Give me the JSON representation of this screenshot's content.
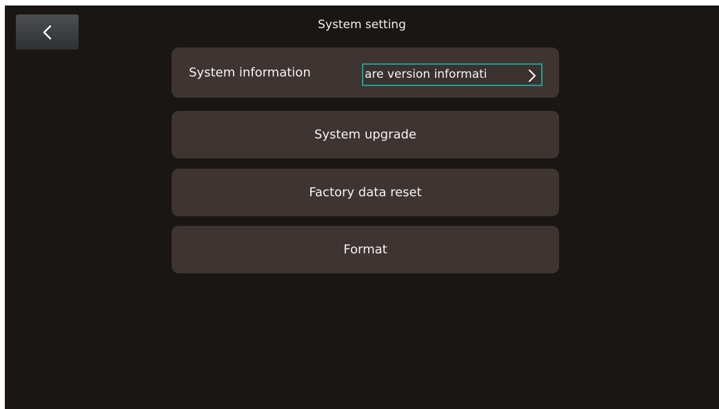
{
  "header": {
    "title": "System setting",
    "back_icon": "chevron-left-icon"
  },
  "settings": {
    "system_information": {
      "label": "System information",
      "value": "are version informati",
      "arrow_icon": "chevron-right-icon"
    },
    "system_upgrade": {
      "label": "System upgrade"
    },
    "factory_data_reset": {
      "label": "Factory data reset"
    },
    "format": {
      "label": "Format"
    }
  },
  "colors": {
    "background": "#1a1613",
    "row": "#3e3431",
    "focus_border": "#1e9f98",
    "text": "#f4f4f4"
  }
}
